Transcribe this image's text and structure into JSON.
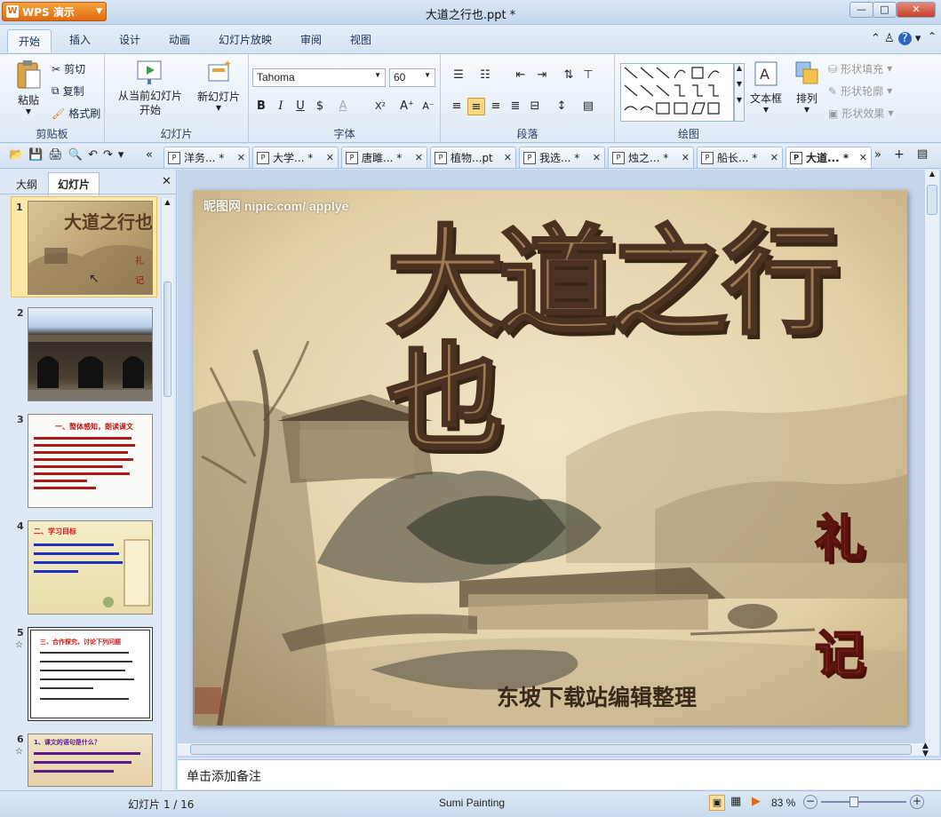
{
  "app": {
    "name": "WPS 演示",
    "title": "大道之行也.ppt *"
  },
  "window_controls": {
    "minimize": "—",
    "maximize": "□",
    "close": "✕"
  },
  "ribbon_tabs": [
    "开始",
    "插入",
    "设计",
    "动画",
    "幻灯片放映",
    "审阅",
    "视图"
  ],
  "clipboard": {
    "paste": "粘贴",
    "cut": "剪切",
    "copy": "复制",
    "format_painter": "格式刷",
    "group": "剪贴板"
  },
  "slides_group": {
    "from_current": "从当前幻灯片",
    "start": "开始",
    "new_slide": "新幻灯片",
    "group": "幻灯片"
  },
  "font_group": {
    "font_name": "Tahoma",
    "font_size": "60",
    "group": "字体"
  },
  "paragraph_group": {
    "group": "段落"
  },
  "drawing_group": {
    "textbox": "文本框",
    "arrange": "排列",
    "shape_fill": "形状填充",
    "shape_outline": "形状轮廓",
    "shape_effect": "形状效果",
    "group": "绘图"
  },
  "doc_tabs": [
    "洋务... *",
    "大学... *",
    "唐雎... *",
    "植物...pt",
    "我选... *",
    "烛之... *",
    "船长... *",
    "大道... *"
  ],
  "panel_tabs": {
    "outline": "大纲",
    "slides": "幻灯片"
  },
  "thumbnails": [
    {
      "num": "1"
    },
    {
      "num": "2"
    },
    {
      "num": "3",
      "heading": "一、整体感知，朗读课文"
    },
    {
      "num": "4",
      "heading": "二、学习目标"
    },
    {
      "num": "5",
      "heading": "三、合作探究，讨论下列问题"
    },
    {
      "num": "6",
      "heading": "1、课文的语句是什么？"
    }
  ],
  "slide": {
    "watermark": "昵图网 nipic.com/ applye",
    "title": "大道之行也",
    "side_char_1": "礼",
    "side_char_2": "记",
    "subtitle": "东坡下载站编辑整理"
  },
  "notes_placeholder": "单击添加备注",
  "status": {
    "slide_count": "幻灯片 1 / 16",
    "theme": "Sumi Painting",
    "zoom": "83 %"
  }
}
